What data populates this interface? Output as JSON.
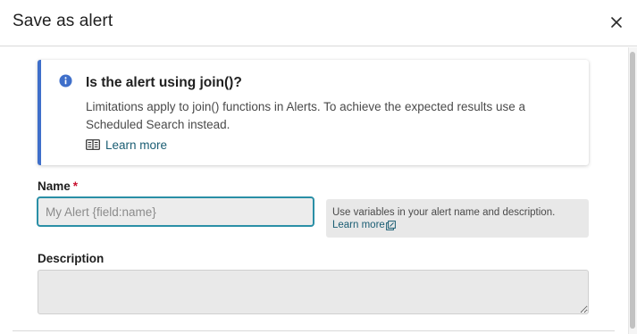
{
  "dialog": {
    "title": "Save as alert"
  },
  "callout": {
    "title": "Is the alert using join()?",
    "body": "Limitations apply to join() functions in Alerts. To achieve the expected results use a Scheduled Search instead.",
    "learn_more": "Learn more",
    "accent_color": "#3f6fca"
  },
  "form": {
    "name_label": "Name",
    "required_marker": "*",
    "name_value": "",
    "name_placeholder": "My Alert {field:name}",
    "hint_text": "Use variables in your alert name and description.",
    "hint_link": "Learn more",
    "description_label": "Description",
    "description_value": ""
  },
  "icons": {
    "close": "close-icon",
    "info": "info-icon",
    "book": "book-icon",
    "external_link": "external-link-icon"
  }
}
